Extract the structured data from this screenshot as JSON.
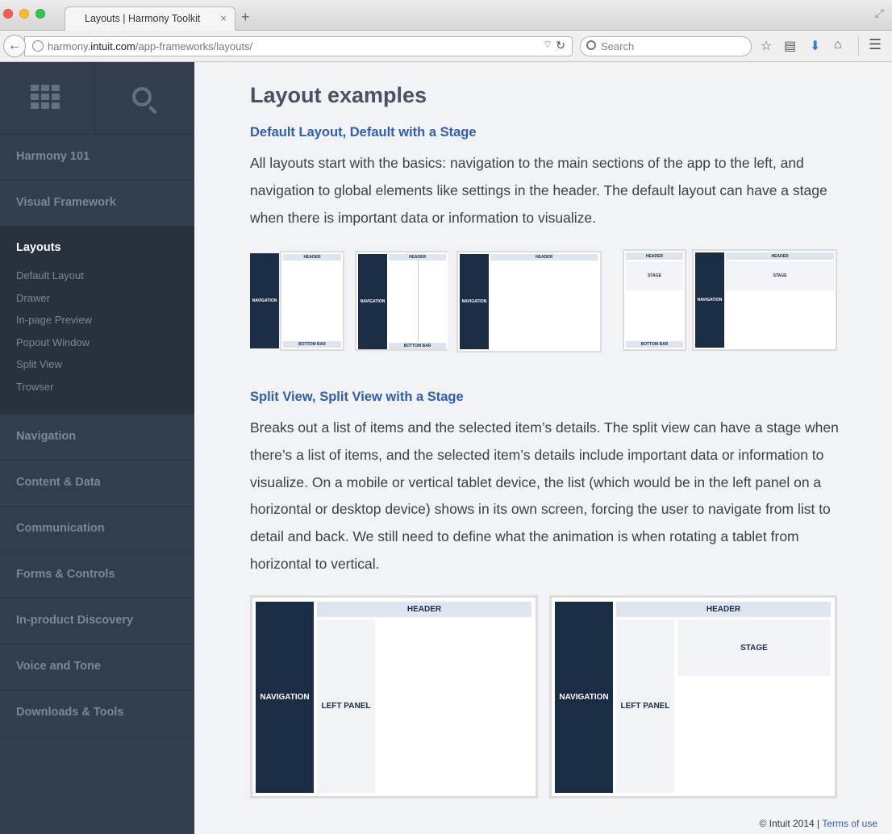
{
  "browser": {
    "tab_title": "Layouts | Harmony Toolkit",
    "tab_close": "×",
    "new_tab": "+",
    "url_host_pre": "harmony.",
    "url_host_domain": "intuit.com",
    "url_path": "/app-frameworks/layouts/",
    "search_placeholder": "Search"
  },
  "sidebar": {
    "items_top": [
      "Harmony 101",
      "Visual Framework"
    ],
    "active": {
      "title": "Layouts",
      "subitems": [
        "Default Layout",
        "Drawer",
        "In-page Preview",
        "Popout Window",
        "Split View",
        "Trowser"
      ]
    },
    "items_bottom": [
      "Navigation",
      "Content & Data",
      "Communication",
      "Forms & Controls",
      "In-product Discovery",
      "Voice and Tone",
      "Downloads & Tools"
    ]
  },
  "main": {
    "title": "Layout examples",
    "section1": {
      "heading": "Default Layout, Default with a Stage",
      "body": "All layouts start with the basics: navigation to the main sections of the app to the left, and navigation to global elements like settings in the header. The default layout can have a stage when there is important data or information to visualize."
    },
    "section2": {
      "heading": "Split View, Split View with a Stage",
      "body": "Breaks out a list of items and the selected item’s details. The split view can have a stage when there’s a list of items, and the selected item’s details include important data or information to visualize. On a mobile or vertical tablet device, the list (which would be in the left panel on a horizontal or desktop device) shows in its own screen, forcing the user to navigate from list to detail and back. We still need to define what the animation is when rotating a tablet from horizontal to vertical."
    },
    "mock_labels": {
      "navigation": "NAVIGATION",
      "header": "HEADER",
      "bottom_bar": "BOTTOM BAR",
      "stage": "STAGE",
      "left_panel": "LEFT PANEL"
    }
  },
  "footer": {
    "copyright": "© Intuit 2014",
    "separator": "|",
    "terms": "Terms of use"
  }
}
